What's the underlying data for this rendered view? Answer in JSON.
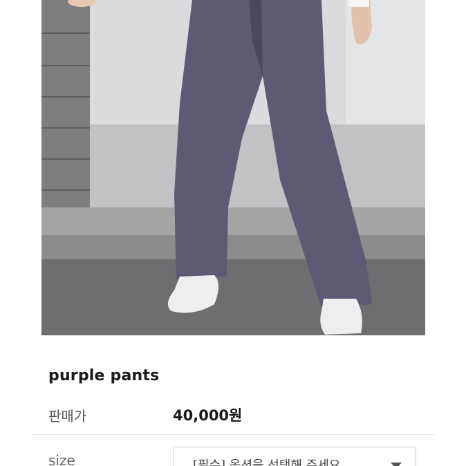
{
  "product": {
    "title": "purple pants",
    "photo_icon": "product-photo"
  },
  "price": {
    "label": "판매가",
    "value": "40,000원"
  },
  "options": {
    "size_label": "size",
    "size_selected": "[필수] 옵션을 선택해 주세요",
    "dropdown_icon": "chevron-down-icon"
  },
  "colors": {
    "pants": "#5d5a73",
    "wall": "#d8dadb",
    "ground": "#6c6e70",
    "text": "#1a1a1a"
  }
}
